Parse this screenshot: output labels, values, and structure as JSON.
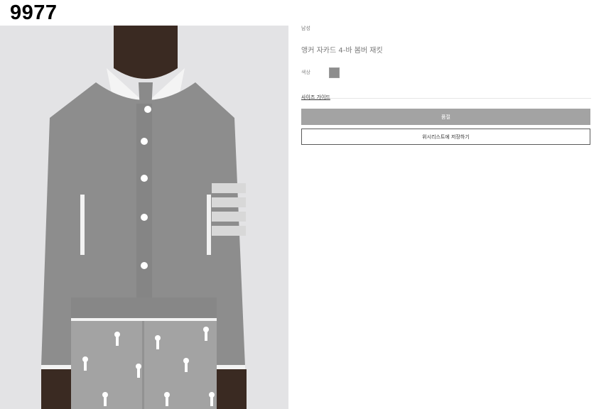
{
  "watermark": "9977",
  "product": {
    "category": "남성",
    "name": "앵커 자카드 4-바 봄버 재킷",
    "color_label": "색상",
    "color_swatch": "#8d8d8d",
    "size_guide": "사이즈 가이드",
    "soldout_button": "품절",
    "wishlist_button": "위시리스트에 저장하기"
  }
}
